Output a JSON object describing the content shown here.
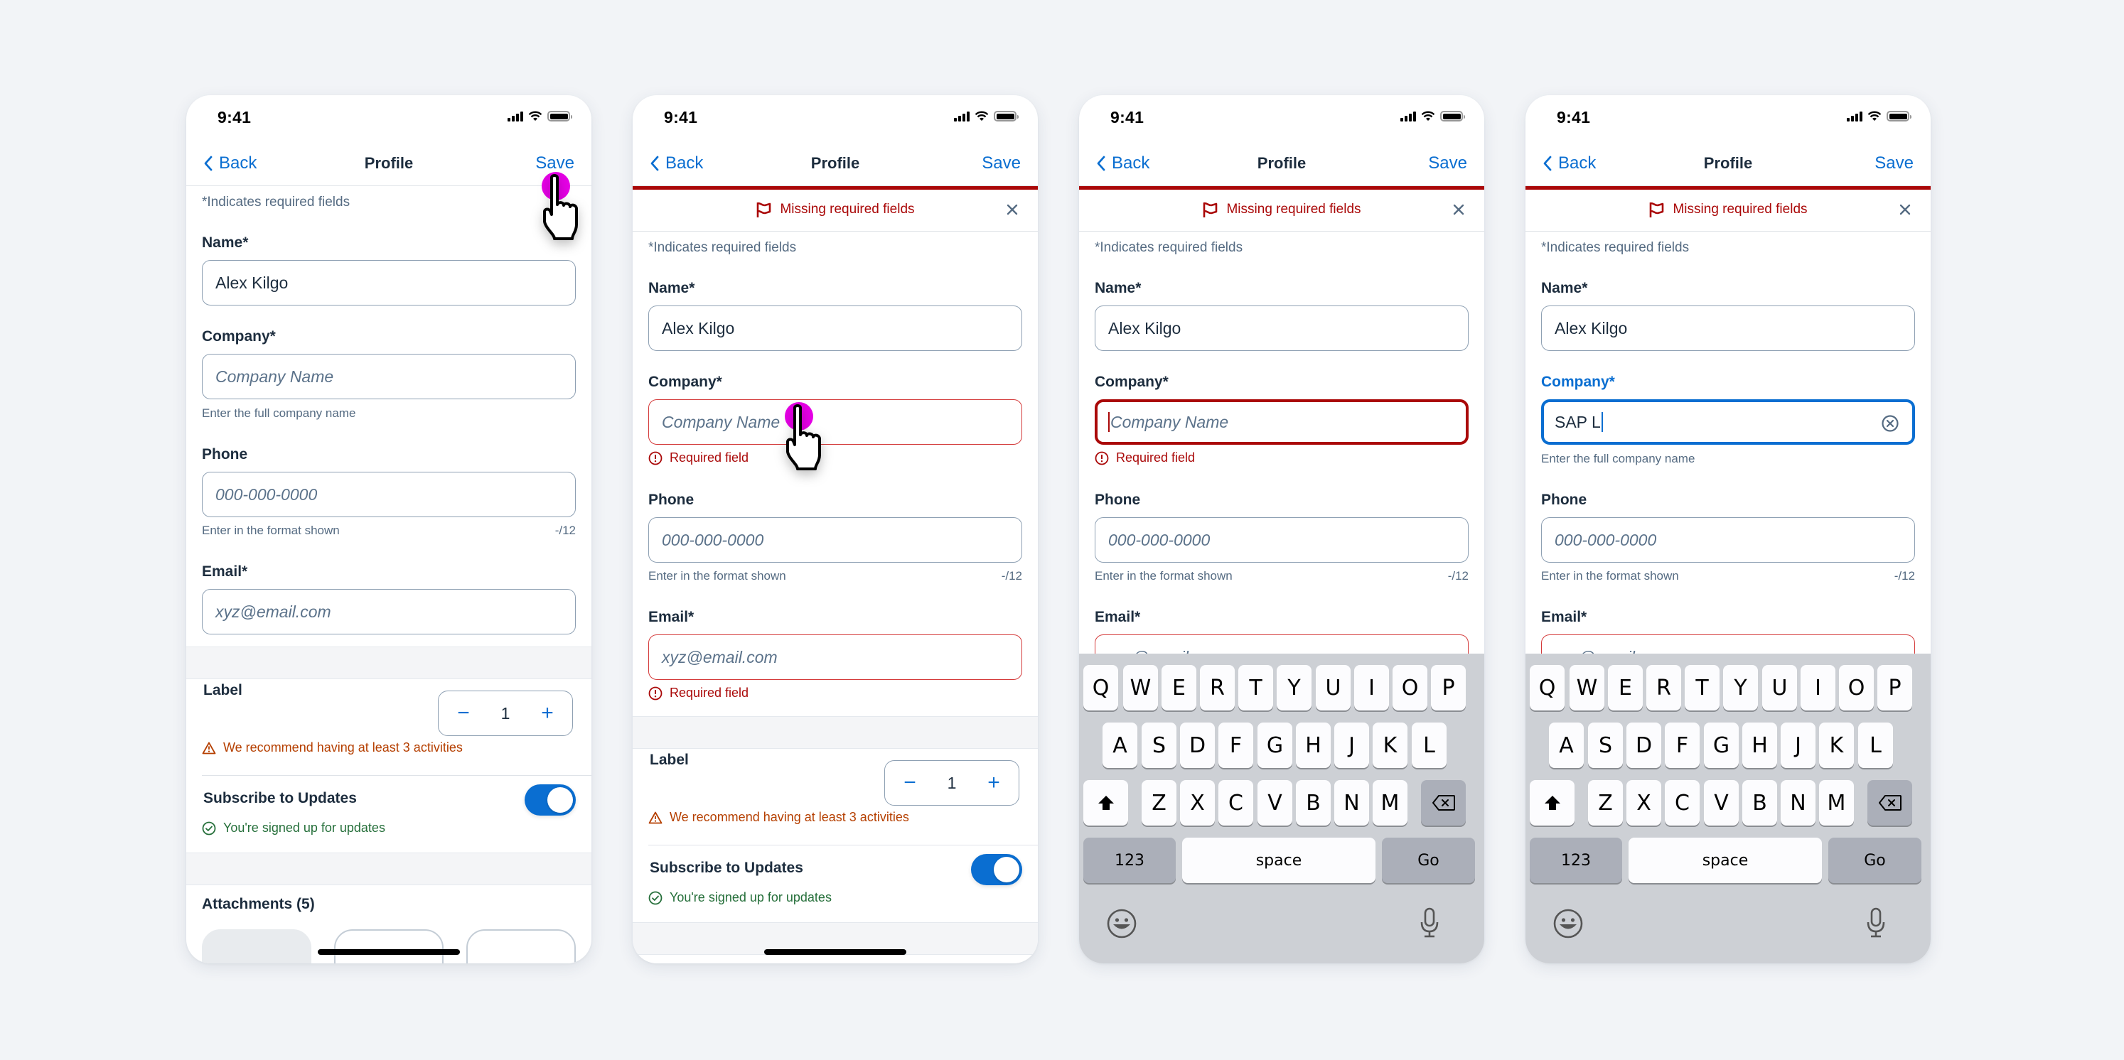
{
  "status_bar": {
    "time": "9:41"
  },
  "nav": {
    "back_label": "Back",
    "title": "Profile",
    "save_label": "Save"
  },
  "banner": {
    "message": "Missing required fields"
  },
  "form": {
    "required_note": "*Indicates required fields",
    "name": {
      "label": "Name*",
      "value": "Alex Kilgo"
    },
    "company": {
      "label": "Company*",
      "placeholder": "Company Name",
      "helper": "Enter the full company name",
      "error": "Required field",
      "typed_value": "SAP L"
    },
    "phone": {
      "label": "Phone",
      "placeholder": "000-000-0000",
      "helper": "Enter in the format shown",
      "counter": "-/12"
    },
    "email": {
      "label": "Email*",
      "placeholder": "xyz@email.com",
      "error": "Required field"
    }
  },
  "stepper": {
    "label": "Label",
    "value": "1",
    "minus": "−",
    "plus": "+",
    "warning": "We recommend having at least 3 activities"
  },
  "subscribe": {
    "label": "Subscribe to Updates",
    "on": true,
    "success": "You're signed up for updates"
  },
  "attachments": {
    "title": "Attachments (5)"
  },
  "keyboard": {
    "row1": [
      "Q",
      "W",
      "E",
      "R",
      "T",
      "Y",
      "U",
      "I",
      "O",
      "P"
    ],
    "row2": [
      "A",
      "S",
      "D",
      "F",
      "G",
      "H",
      "J",
      "K",
      "L"
    ],
    "row3": [
      "Z",
      "X",
      "C",
      "V",
      "B",
      "N",
      "M"
    ],
    "numbers": "123",
    "space": "space",
    "go": "Go"
  },
  "colors": {
    "accent": "#0a6ed1",
    "error": "#aa0808",
    "warning": "#b53f00",
    "success": "#256f3a",
    "tap": "#e600e6"
  }
}
